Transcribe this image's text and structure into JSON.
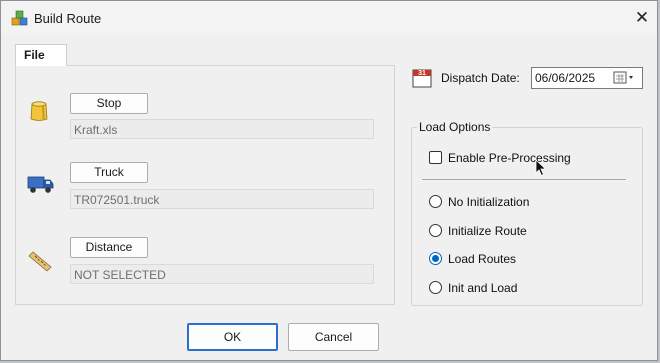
{
  "window": {
    "title": "Build Route",
    "close_label": "✕",
    "app_icon": "cube-stack-icon"
  },
  "tab": {
    "label": "File"
  },
  "files": [
    {
      "icon": "barrel-icon",
      "button": "Stop",
      "value": "Kraft.xls"
    },
    {
      "icon": "truck-icon",
      "button": "Truck",
      "value": "TR072501.truck"
    },
    {
      "icon": "ruler-icon",
      "button": "Distance",
      "value": "NOT SELECTED"
    }
  ],
  "dispatch": {
    "label": "Dispatch Date:",
    "value": "06/06/2025",
    "calendar_badge": "31"
  },
  "load_options": {
    "legend": "Load Options",
    "preprocess": {
      "label": "Enable Pre-Processing",
      "checked": false
    },
    "radios": [
      {
        "label": "No Initialization",
        "checked": false
      },
      {
        "label": "Initialize Route",
        "checked": false
      },
      {
        "label": "Load Routes",
        "checked": true
      },
      {
        "label": "Init and Load",
        "checked": false
      }
    ]
  },
  "footer": {
    "ok": "OK",
    "cancel": "Cancel"
  },
  "colors": {
    "accent": "#0067c0",
    "window_bg": "#f0f0f0"
  }
}
